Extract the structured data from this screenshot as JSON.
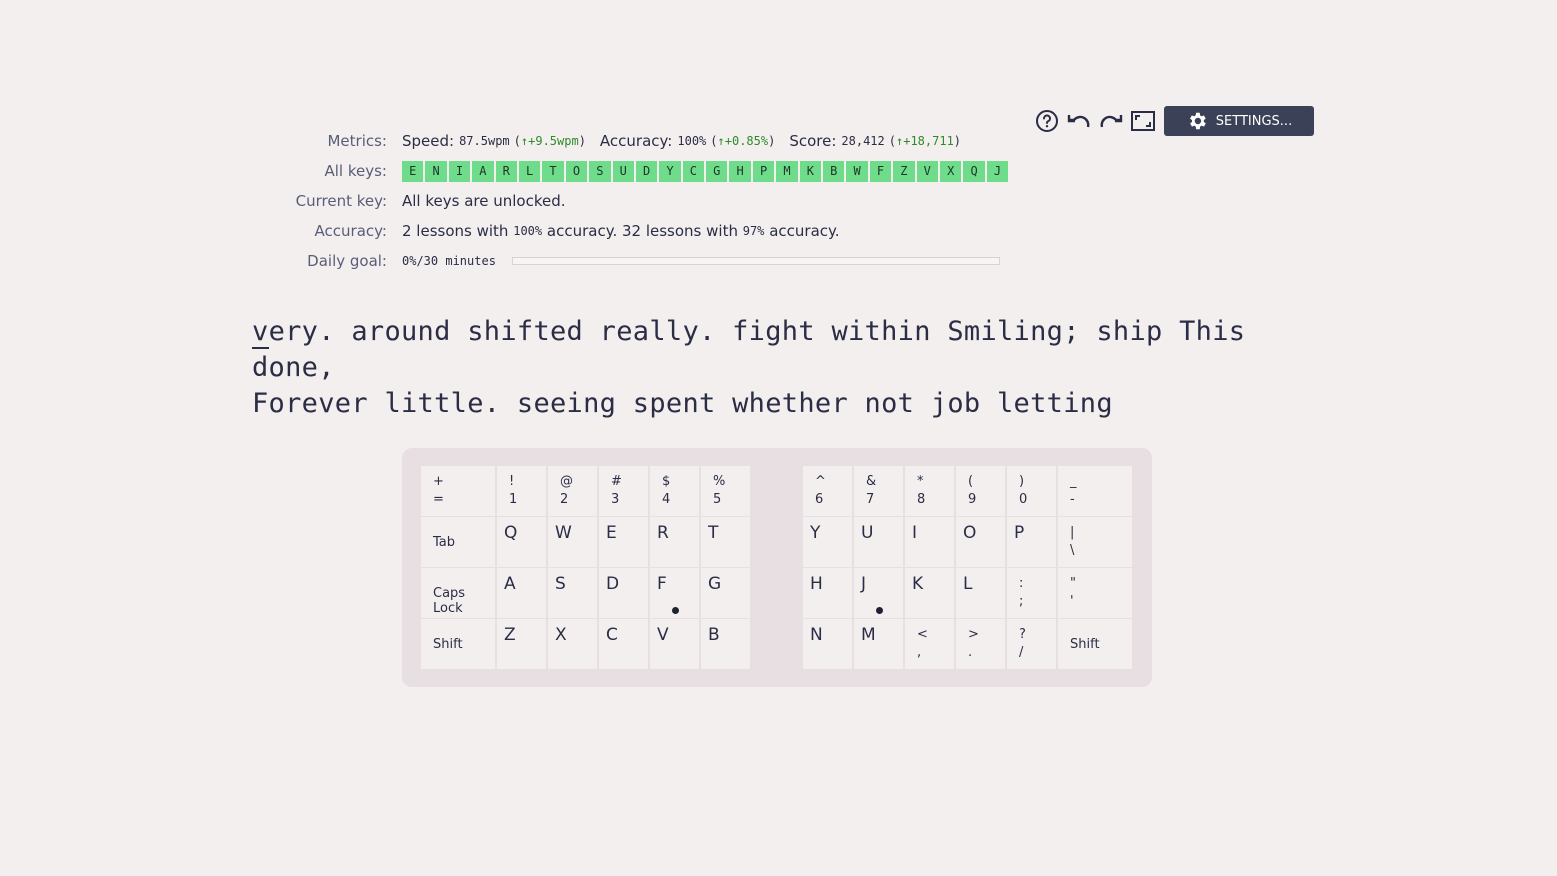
{
  "toolbar": {
    "help_icon": "help-circle-icon",
    "undo_icon": "undo-icon",
    "redo_icon": "redo-icon",
    "fullscreen_icon": "fullscreen-icon",
    "settings_label": "SETTINGS..."
  },
  "stats": {
    "metrics_label": "Metrics:",
    "speed_label": "Speed:",
    "speed_value": "87.5wpm",
    "speed_delta": "↑+9.5wpm",
    "accuracy_label": "Accuracy:",
    "accuracy_value": "100%",
    "accuracy_delta": "↑+0.85%",
    "score_label": "Score:",
    "score_value": "28,412",
    "score_delta": "↑+18,711",
    "all_keys_label": "All keys:",
    "all_keys": [
      "E",
      "N",
      "I",
      "A",
      "R",
      "L",
      "T",
      "O",
      "S",
      "U",
      "D",
      "Y",
      "C",
      "G",
      "H",
      "P",
      "M",
      "K",
      "B",
      "W",
      "F",
      "Z",
      "V",
      "X",
      "Q",
      "J"
    ],
    "current_key_label": "Current key:",
    "current_key_text": "All keys are unlocked.",
    "accuracy_row_label": "Accuracy:",
    "acc_part1": "2 lessons with",
    "acc_val1": "100%",
    "acc_part2": "accuracy. 32 lessons with",
    "acc_val2": "97%",
    "acc_part3": "accuracy.",
    "daily_goal_label": "Daily goal:",
    "daily_goal_value": "0%/30 minutes",
    "daily_goal_progress": 0
  },
  "lesson": {
    "cursor_char": "v",
    "line1_rest": "ery. around shifted really. fight within Smiling; ship This done,",
    "line2": "Forever little. seeing spent whether not job letting"
  },
  "keyboard": {
    "left": {
      "row1": [
        {
          "top": "+",
          "bot": "="
        },
        {
          "top": "!",
          "bot": "1"
        },
        {
          "top": "@",
          "bot": "2"
        },
        {
          "top": "#",
          "bot": "3"
        },
        {
          "top": "$",
          "bot": "4"
        },
        {
          "top": "%",
          "bot": "5"
        }
      ],
      "tab": "Tab",
      "row2": [
        "Q",
        "W",
        "E",
        "R",
        "T"
      ],
      "caps": "Caps Lock",
      "row3": [
        "A",
        "S",
        "D",
        "F",
        "G"
      ],
      "shift": "Shift",
      "row4": [
        "Z",
        "X",
        "C",
        "V",
        "B"
      ]
    },
    "right": {
      "row1": [
        {
          "top": "^",
          "bot": "6"
        },
        {
          "top": "&",
          "bot": "7"
        },
        {
          "top": "*",
          "bot": "8"
        },
        {
          "top": "(",
          "bot": "9"
        },
        {
          "top": ")",
          "bot": "0"
        },
        {
          "top": "_",
          "bot": "-"
        }
      ],
      "row2": [
        "Y",
        "U",
        "I",
        "O",
        "P"
      ],
      "row2_pipe": {
        "top": "|",
        "bot": "\\"
      },
      "row3": [
        "H",
        "J",
        "K",
        "L"
      ],
      "row3_colon": {
        "top": ":",
        "bot": ";"
      },
      "row3_quote": {
        "top": "\"",
        "bot": "'"
      },
      "row4": [
        "N",
        "M"
      ],
      "row4_lt": {
        "top": "<",
        "bot": ","
      },
      "row4_gt": {
        "top": ">",
        "bot": "."
      },
      "row4_q": {
        "top": "?",
        "bot": "/"
      },
      "shift": "Shift"
    }
  }
}
